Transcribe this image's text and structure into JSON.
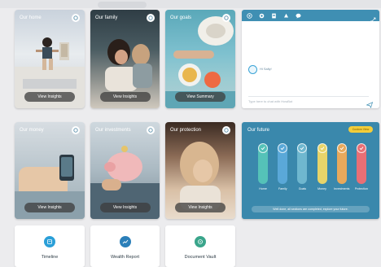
{
  "cards": [
    {
      "id": "home",
      "title": "Our home",
      "button": "View Insights"
    },
    {
      "id": "family",
      "title": "Our family",
      "button": "View Insights"
    },
    {
      "id": "goals",
      "title": "Our goals",
      "button": "View Summary"
    },
    {
      "id": "money",
      "title": "Our money",
      "button": "View Insights"
    },
    {
      "id": "investments",
      "title": "Our investments",
      "button": "View Insights"
    },
    {
      "id": "protection",
      "title": "Our protection",
      "button": "View Insights"
    }
  ],
  "chat": {
    "toolbar_icons": [
      "target-icon",
      "settings-icon",
      "document-icon",
      "bell-icon",
      "chat-bubble-icon"
    ],
    "bot_message": "Hi Sally!",
    "input_placeholder": "Type here to chat with HowBot"
  },
  "future": {
    "title": "Our future",
    "action_button": "Custom View",
    "bars": [
      {
        "label": "Home",
        "level": 1.0,
        "color": "#55c2b8"
      },
      {
        "label": "Family",
        "level": 1.0,
        "color": "#5aa8d8"
      },
      {
        "label": "Goals",
        "level": 1.0,
        "color": "#6fb7cf"
      },
      {
        "label": "Money",
        "level": 1.0,
        "color": "#e7d46a"
      },
      {
        "label": "Investments",
        "level": 1.0,
        "color": "#e8a95c"
      },
      {
        "label": "Protection",
        "level": 1.0,
        "color": "#e86f75"
      }
    ],
    "note": "Well done, all sections are completed, explore your future."
  },
  "tiles": [
    {
      "label": "Timeline",
      "icon": "timeline-icon",
      "color": "#2a9fd8"
    },
    {
      "label": "Wealth Report",
      "icon": "chart-icon",
      "color": "#2b7fb9"
    },
    {
      "label": "Document Vault",
      "icon": "vault-icon",
      "color": "#3aa58b"
    }
  ]
}
